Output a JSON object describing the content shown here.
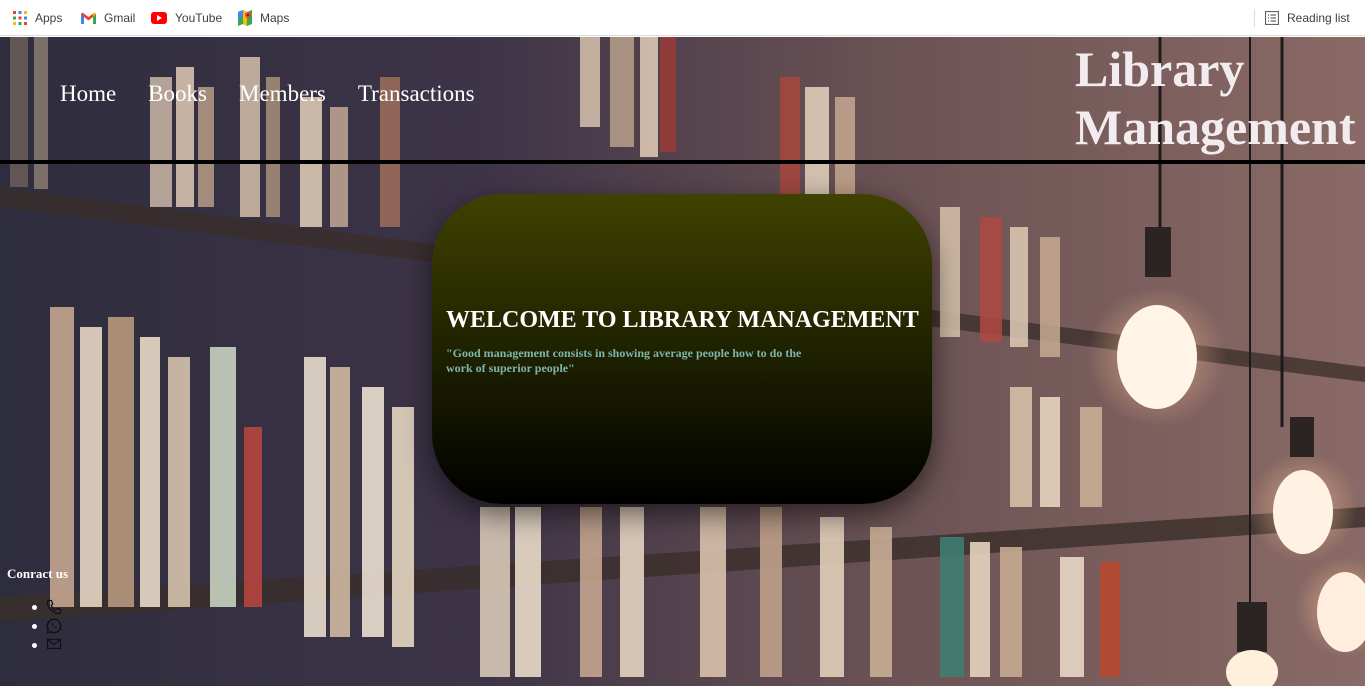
{
  "bookmarks": {
    "apps": "Apps",
    "gmail": "Gmail",
    "youtube": "YouTube",
    "maps": "Maps",
    "reading_list": "Reading list"
  },
  "nav": {
    "items": [
      "Home",
      "Books",
      "Members",
      "Transactions"
    ]
  },
  "brand": {
    "line1": "Library",
    "line2": "Management"
  },
  "welcome": {
    "title": "WELCOME TO LIBRARY MANAGEMENT",
    "quote": "\"Good management consists in showing average people how to do the work of superior people\""
  },
  "contact": {
    "heading": "Conract us",
    "icons": [
      "phone-icon",
      "whatsapp-icon",
      "mail-icon"
    ]
  },
  "colors": {
    "card_top": "#3f4200",
    "card_bottom": "#000000",
    "quote_text": "#7fb5aa",
    "divider": "#000000"
  }
}
